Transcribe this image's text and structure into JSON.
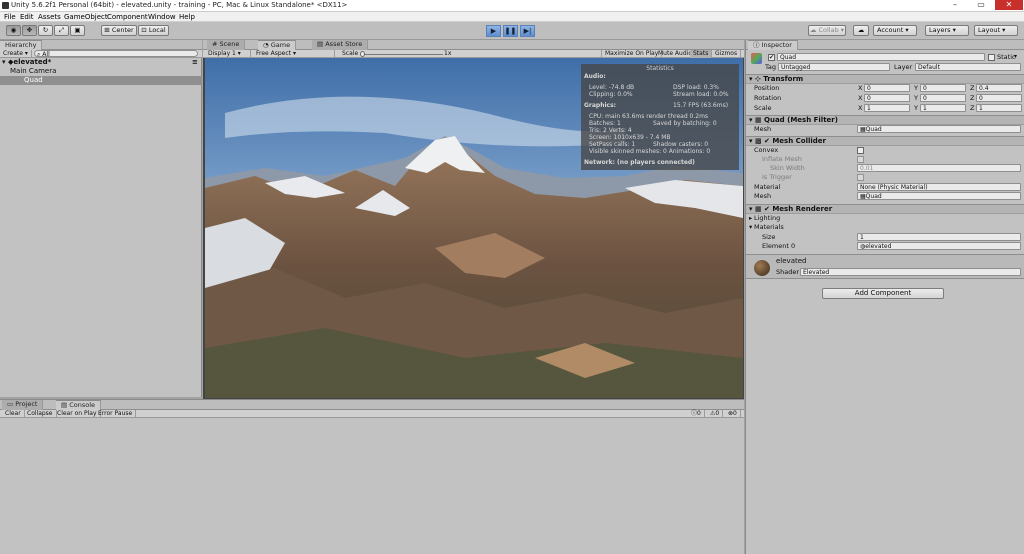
{
  "title": "Unity 5.6.2f1 Personal (64bit) - elevated.unity - training - PC, Mac & Linux Standalone* <DX11>",
  "menu": [
    "File",
    "Edit",
    "Assets",
    "GameObject",
    "Component",
    "Window",
    "Help"
  ],
  "toolbar": {
    "center": "Center",
    "local": "Local",
    "collab": "Collab",
    "account": "Account",
    "layers": "Layers",
    "layout": "Layout"
  },
  "hierarchy": {
    "tab": "Hierarchy",
    "create": "Create",
    "search_placeholder": "All",
    "scene": "elevated*",
    "items": [
      "Main Camera",
      "Quad"
    ]
  },
  "game": {
    "tabs": [
      "Scene",
      "Game",
      "Asset Store"
    ],
    "display": "Display 1",
    "aspect": "Free Aspect",
    "scale_label": "Scale",
    "scale_value": "1x",
    "buttons": [
      "Maximize On Play",
      "Mute Audio",
      "Stats",
      "Gizmos"
    ]
  },
  "stats": {
    "title": "Statistics",
    "audio": "Audio:",
    "level": "Level: -74.8 dB",
    "clipping": "Clipping: 0.0%",
    "dsp": "DSP load: 0.3%",
    "stream": "Stream load: 0.0%",
    "graphics": "Graphics:",
    "fps": "15.7 FPS (63.6ms)",
    "cpu": "CPU: main 63.6ms  render thread 0.2ms",
    "batches": "Batches: 1",
    "saved": "Saved by batching: 0",
    "tris": "Tris: 2    Verts: 4",
    "screen": "Screen: 1010x639 - 7.4 MB",
    "setpass": "SetPass calls: 1",
    "shadow": "Shadow casters: 0",
    "skinned": "Visible skinned meshes: 0  Animations: 0",
    "network": "Network: (no players connected)"
  },
  "bottom": {
    "tabs": [
      "Project",
      "Console"
    ],
    "buttons": [
      "Clear",
      "Collapse",
      "Clear on Play",
      "Error Pause"
    ],
    "counts": [
      "0",
      "0",
      "0"
    ]
  },
  "inspector": {
    "tab": "Inspector",
    "object_name": "Quad",
    "static": "Static",
    "tag_label": "Tag",
    "tag": "Untagged",
    "layer_label": "Layer",
    "layer": "Default",
    "transform": {
      "title": "Transform",
      "rows": [
        {
          "label": "Position",
          "x": "0",
          "y": "0",
          "z": "0.4"
        },
        {
          "label": "Rotation",
          "x": "0",
          "y": "0",
          "z": "0"
        },
        {
          "label": "Scale",
          "x": "1",
          "y": "1",
          "z": "1"
        }
      ]
    },
    "mesh_filter": {
      "title": "Quad (Mesh Filter)",
      "mesh_label": "Mesh",
      "mesh": "Quad"
    },
    "mesh_collider": {
      "title": "Mesh Collider",
      "convex": "Convex",
      "inflate": "Inflate Mesh",
      "skin": "Skin Width",
      "skin_value": "0.01",
      "trigger": "Is Trigger",
      "material_label": "Material",
      "material": "None (Physic Material)",
      "mesh_label": "Mesh",
      "mesh": "Quad"
    },
    "mesh_renderer": {
      "title": "Mesh Renderer",
      "lighting": "Lighting",
      "materials": "Materials",
      "size_label": "Size",
      "size": "1",
      "element_label": "Element 0",
      "element": "elevated"
    },
    "material": {
      "name": "elevated",
      "shader_label": "Shader",
      "shader": "Elevated"
    },
    "add_component": "Add Component"
  },
  "axis": {
    "x": "X",
    "y": "Y",
    "z": "Z"
  }
}
